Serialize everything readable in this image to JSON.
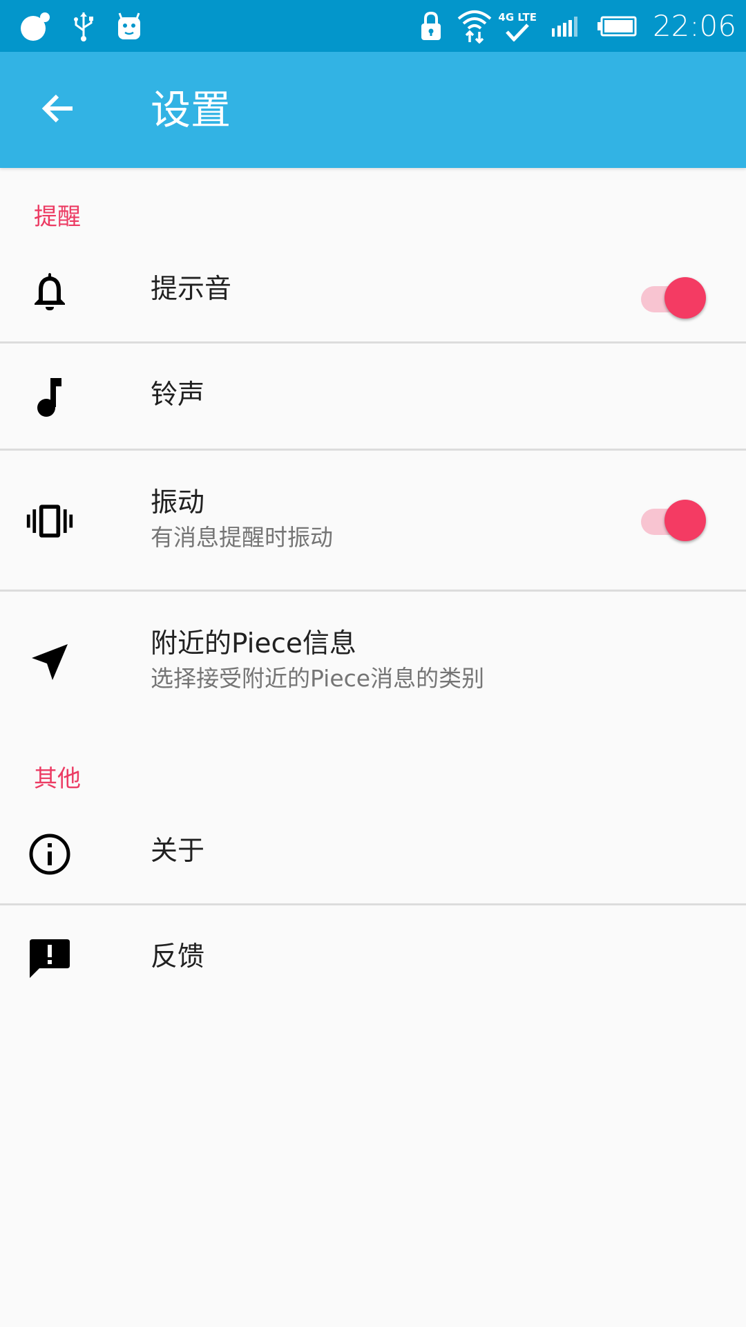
{
  "status_bar": {
    "left_icons": [
      "chat-bubble-icon",
      "usb-icon",
      "android-debug-icon"
    ],
    "network_label": "4G LTE",
    "time": "22:06",
    "background_color": "#0396cb"
  },
  "app_bar": {
    "title": "设置",
    "back_icon": "arrow-back-icon",
    "background_color": "#32b3e4"
  },
  "sections": {
    "reminder": {
      "header": "提醒",
      "notification_sound": {
        "title": "提示音",
        "icon": "bell-icon",
        "switch_on": true
      },
      "ringtone": {
        "title": "铃声",
        "icon": "music-note-icon"
      },
      "vibration": {
        "title": "振动",
        "summary": "有消息提醒时振动",
        "icon": "vibrate-icon",
        "switch_on": true
      },
      "nearby": {
        "title": "附近的Piece信息",
        "summary": "选择接受附近的Piece消息的类别",
        "icon": "navigation-arrow-icon"
      }
    },
    "other": {
      "header": "其他",
      "about": {
        "title": "关于",
        "icon": "info-icon"
      },
      "feedback": {
        "title": "反馈",
        "icon": "feedback-icon"
      }
    }
  },
  "colors": {
    "accent": "#f43b63",
    "section_header": "#ec3b63",
    "switch_track": "#f8c4d1"
  }
}
